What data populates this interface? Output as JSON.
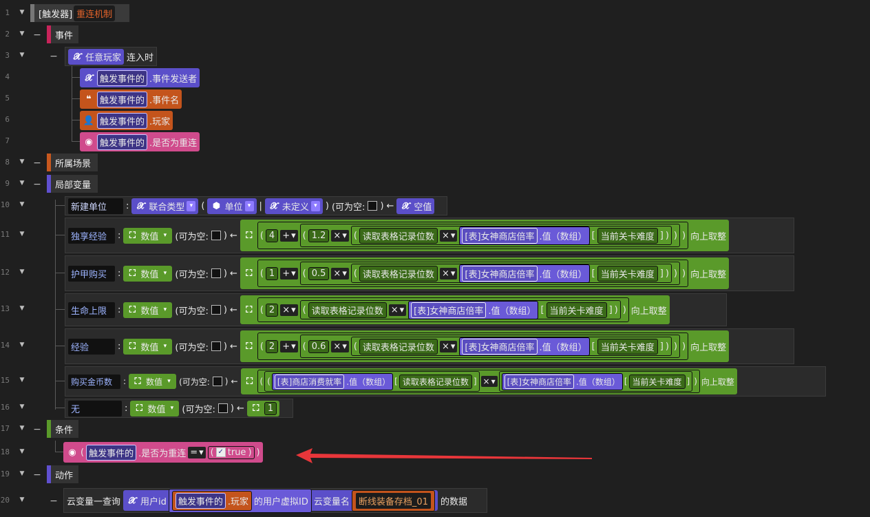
{
  "lines": [
    "1",
    "2",
    "3",
    "4",
    "5",
    "6",
    "7",
    "8",
    "9",
    "10",
    "11",
    "12",
    "13",
    "14",
    "15",
    "16",
    "17",
    "18",
    "19",
    "20"
  ],
  "trigger": {
    "prefix": "[触发器]",
    "name": "重连机制"
  },
  "sections": {
    "event": "事件",
    "scene": "所属场景",
    "local_vars": "局部变量",
    "condition": "条件",
    "action": "动作"
  },
  "event": {
    "any_player": "任意玩家",
    "on_connect": "连入时",
    "params": [
      {
        "source": "触发事件的",
        "field": ".事件发送者"
      },
      {
        "source": "触发事件的",
        "field": ".事件名"
      },
      {
        "source": "触发事件的",
        "field": ".玩家"
      },
      {
        "source": "触发事件的",
        "field": ".是否为重连"
      }
    ]
  },
  "common": {
    "nullable": "(可为空:",
    "nullable_end": ")",
    "assign": "←",
    "number": "数值",
    "round_up": "向上取整",
    "read_table": "读取表格记录位数",
    "shop_rate": "[表]女神商店倍率",
    "value_array": ".值（数组）",
    "stage_difficulty": "当前关卡难度",
    "plus": "+",
    "times": "×",
    "lbr": "[",
    "rbr": "]",
    "lp": "(",
    "rp": ")"
  },
  "vars": [
    {
      "name": "新建单位",
      "union": "联合类型",
      "unit": "单位",
      "undefined": "未定义",
      "default": "空值"
    },
    {
      "name": "独享经验",
      "a": "4",
      "b": "1.2"
    },
    {
      "name": "护甲购买",
      "a": "1",
      "b": "0.5"
    },
    {
      "name": "生命上限",
      "a": "2"
    },
    {
      "name": "经验",
      "a": "2",
      "b": "0.6"
    },
    {
      "name": "购买金币数",
      "consume": "[表]商店消费就率"
    },
    {
      "name": "无",
      "value": "1"
    }
  ],
  "condition": {
    "source": "触发事件的",
    "field": ".是否为重连",
    "op": "=",
    "value": "true"
  },
  "action": {
    "label": "云变量一查询",
    "user_id": "用户id",
    "source": "触发事件的",
    "field": ".玩家",
    "virtual_id": "的用户虚拟ID",
    "var_name_label": "云变量名",
    "var_name": "断线装备存档_01",
    "suffix": "的数据"
  },
  "colors": {
    "purple": "#5b4fc9",
    "orange": "#c4541c",
    "pink": "#d04b8c",
    "green": "#5a9a2a",
    "red_arrow": "#e8363a"
  }
}
